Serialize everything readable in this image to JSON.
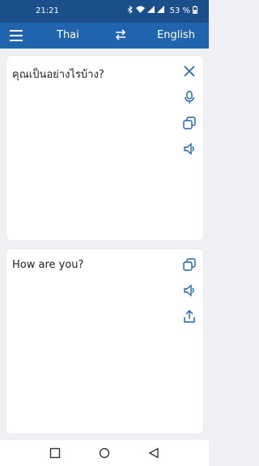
{
  "status_bar": {
    "time": "21:21",
    "battery_text": "53 %",
    "icons": [
      "bluetooth-icon",
      "wifi-icon",
      "signal-icon",
      "signal-icon",
      "battery-icon"
    ]
  },
  "app_bar": {
    "menu_icon": "hamburger-menu-icon",
    "source_language": "Thai",
    "swap_icon": "swap-arrows-icon",
    "target_language": "English"
  },
  "source_card": {
    "text": "คุณเป็นอย่างไรบ้าง?",
    "tools": [
      "close-icon",
      "microphone-icon",
      "copy-icon",
      "speaker-icon"
    ]
  },
  "target_card": {
    "text": "How are you?",
    "tools": [
      "copy-icon",
      "speaker-icon",
      "share-icon"
    ]
  },
  "nav_bar": {
    "buttons": [
      "recents-square-icon",
      "home-circle-icon",
      "back-triangle-icon"
    ]
  },
  "colors": {
    "accent": "#1f64ac",
    "status_bar": "#1a4f8b",
    "icon_blue": "#1f64ac",
    "background": "#eef0f3"
  }
}
